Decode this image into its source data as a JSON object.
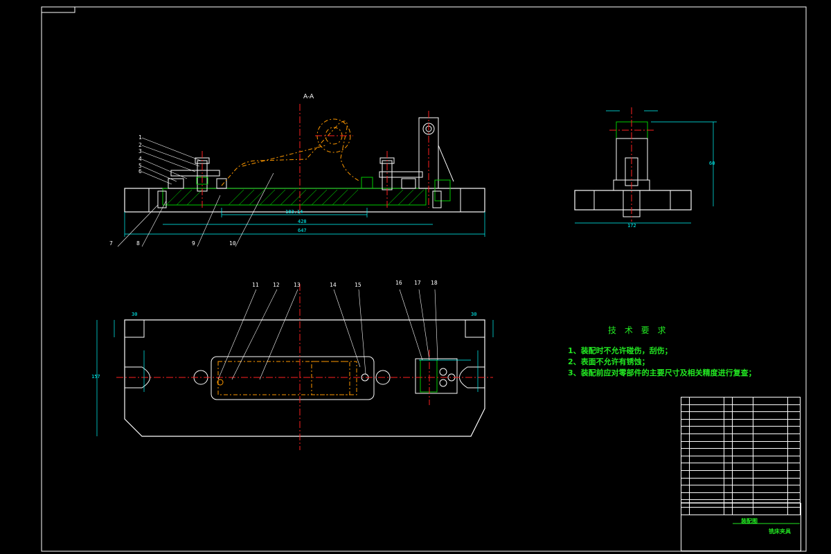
{
  "section_label": "A-A",
  "tech_requirements": {
    "title": "技 术 要 求",
    "items": [
      "1、装配时不允许碰伤，刮伤；",
      "2、表面不允许有锈蚀；",
      "3、装配前应对零部件的主要尺寸及相关精度进行复查；"
    ]
  },
  "callouts_top": [
    "1",
    "2",
    "3",
    "4",
    "5",
    "6",
    "7",
    "8",
    "9",
    "10"
  ],
  "callouts_plan": [
    "11",
    "12",
    "13",
    "14",
    "15",
    "16",
    "17",
    "18"
  ],
  "dimensions": {
    "front_overall": "647",
    "front_inner": "428",
    "front_center": "183.14",
    "side_height": "60",
    "side_width": "172",
    "plan_height": "157",
    "plan_slot": "30"
  },
  "title_block": {
    "drawing_name": "装配图",
    "part_name": "铣床夹具"
  },
  "colors": {
    "background": "#000000",
    "frame": "#ffffff",
    "text_green": "#22e822",
    "dimension": "#00ffff",
    "center_line": "#ff2020",
    "hidden_part": "#ff9900",
    "section_hatch": "#00cc00"
  }
}
